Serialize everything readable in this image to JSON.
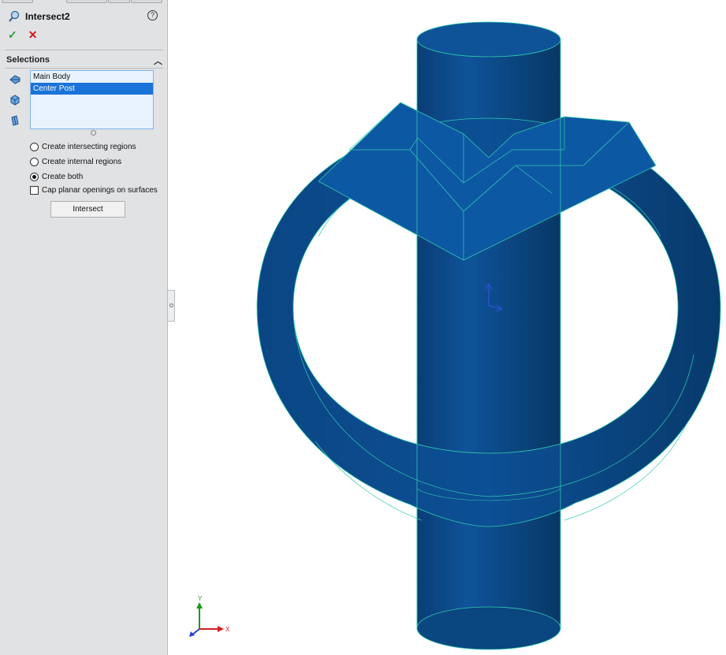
{
  "feature": {
    "title": "Intersect2",
    "help_icon": "help-icon",
    "ok_icon": "checkmark-icon",
    "cancel_icon": "close-icon"
  },
  "selections": {
    "header": "Selections",
    "items": [
      {
        "label": "Main Body",
        "selected": false
      },
      {
        "label": "Center Post",
        "selected": true
      }
    ]
  },
  "options": {
    "intersecting": {
      "label": "Create intersecting regions",
      "checked": false
    },
    "internal": {
      "label": "Create internal regions",
      "checked": false
    },
    "both": {
      "label": "Create both",
      "checked": true
    },
    "cap": {
      "label": "Cap planar openings on surfaces",
      "checked": false
    }
  },
  "intersect_button": "Intersect",
  "triad": {
    "y_label": "Y",
    "x_label": "X"
  },
  "colors": {
    "model_fill": "#0b4e92",
    "model_edge": "#2fc9b0",
    "selection_highlight": "#1a73d9"
  }
}
